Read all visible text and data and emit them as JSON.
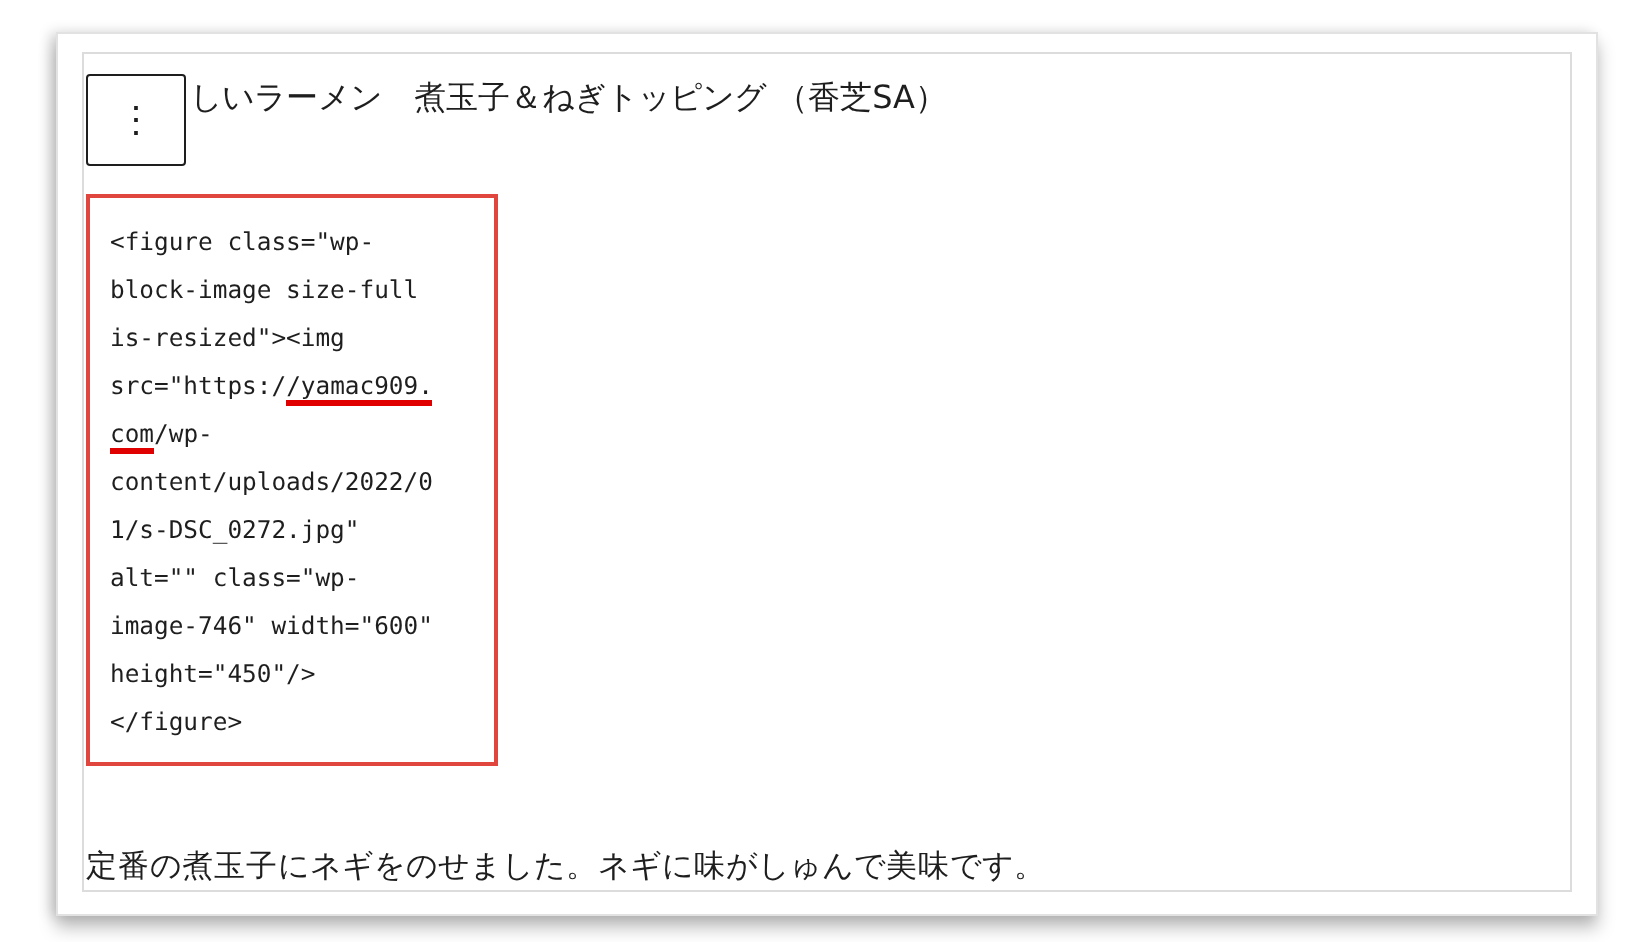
{
  "heading": "しいラーメン　煮玉子＆ねぎトッピング （香芝SA）",
  "options_button": "⋮",
  "code_lines": [
    {
      "segments": [
        {
          "text": "<figure class=\"wp-",
          "underlined": false
        }
      ]
    },
    {
      "segments": [
        {
          "text": "block-image size-full",
          "underlined": false
        }
      ]
    },
    {
      "segments": [
        {
          "text": "is-resized\"><img",
          "underlined": false
        }
      ]
    },
    {
      "segments": [
        {
          "text": "src=\"https:/",
          "underlined": false
        },
        {
          "text": "/yamac909.",
          "underlined": true
        }
      ]
    },
    {
      "segments": [
        {
          "text": "com",
          "underlined": true
        },
        {
          "text": "/wp-",
          "underlined": false
        }
      ]
    },
    {
      "segments": [
        {
          "text": "content/uploads/2022/0",
          "underlined": false
        }
      ]
    },
    {
      "segments": [
        {
          "text": "1/s-DSC_0272.jpg\"",
          "underlined": false
        }
      ]
    },
    {
      "segments": [
        {
          "text": "alt=\"\" class=\"wp-",
          "underlined": false
        }
      ]
    },
    {
      "segments": [
        {
          "text": "image-746\" width=\"600\"",
          "underlined": false
        }
      ]
    },
    {
      "segments": [
        {
          "text": "height=\"450\"/>",
          "underlined": false
        }
      ]
    },
    {
      "segments": [
        {
          "text": "</figure>",
          "underlined": false
        }
      ]
    }
  ],
  "paragraph": "定番の煮玉子にネギをのせました。ネギに味がしゅんで美味です。"
}
